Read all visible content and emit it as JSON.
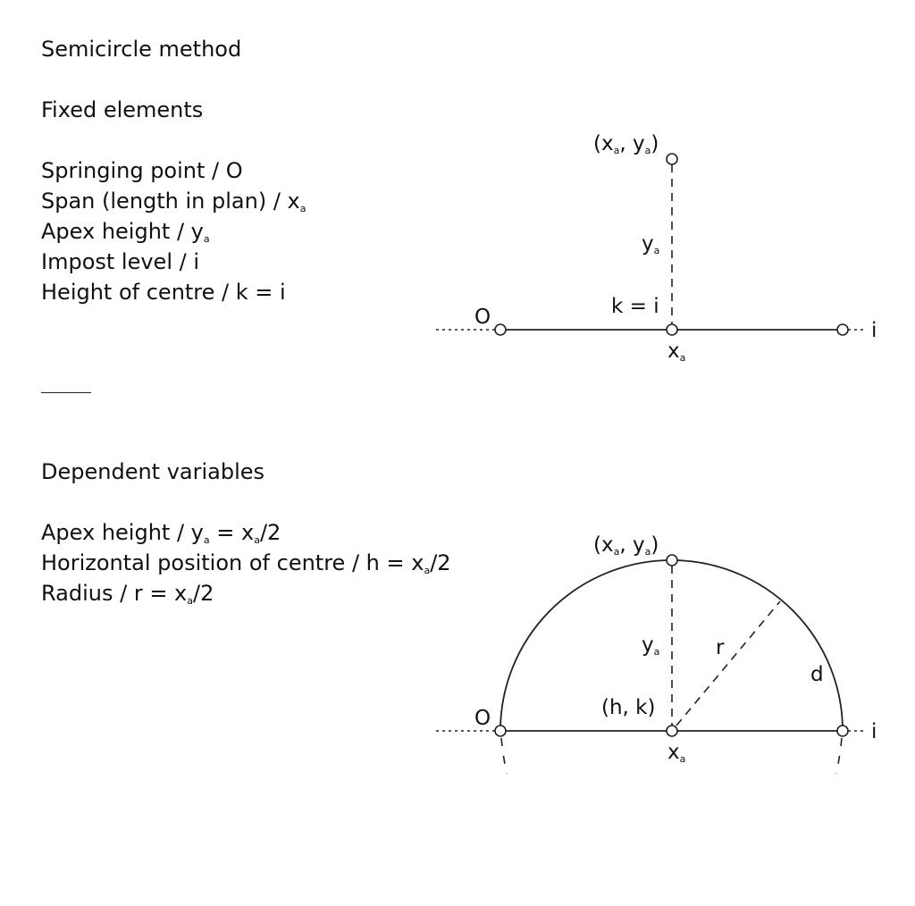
{
  "title": "Semicircle method",
  "fixed": {
    "heading": "Fixed elements",
    "items": [
      {
        "label": "Springing point / O",
        "sub": "",
        "tail": ""
      },
      {
        "label": "Span (length in plan) / x",
        "sub": "a",
        "tail": ""
      },
      {
        "label": "Apex height / y",
        "sub": "a",
        "tail": ""
      },
      {
        "label": "Impost level / i",
        "sub": "",
        "tail": ""
      },
      {
        "label": "Height of centre / k = i",
        "sub": "",
        "tail": ""
      }
    ]
  },
  "dependent": {
    "heading": "Dependent variables",
    "items": [
      {
        "pre": "Apex height / y",
        "sub1": "a",
        "mid": " = x",
        "sub2": "a",
        "post": "/2"
      },
      {
        "pre": "Horizontal position of centre / h = x",
        "sub1": "a",
        "mid": "",
        "sub2": "",
        "post": "/2"
      },
      {
        "pre": "Radius / r = x",
        "sub1": "a",
        "mid": "",
        "sub2": "",
        "post": "/2"
      }
    ]
  },
  "diagram_top": {
    "apex_label": {
      "x": "x",
      "xs": "a",
      "y": "y",
      "ys": "a"
    },
    "ya_label": {
      "base": "y",
      "sub": "a"
    },
    "k_label": "k = i",
    "o_label": "O",
    "i_label": "i",
    "xa_label": {
      "base": "x",
      "sub": "a"
    }
  },
  "diagram_bottom": {
    "apex_label": {
      "x": "x",
      "xs": "a",
      "y": "y",
      "ys": "a"
    },
    "ya_label": {
      "base": "y",
      "sub": "a"
    },
    "r_label": "r",
    "d_label": "d",
    "centre_label": "(h, k)",
    "o_label": "O",
    "i_label": "i",
    "xa_label": {
      "base": "x",
      "sub": "a"
    }
  }
}
